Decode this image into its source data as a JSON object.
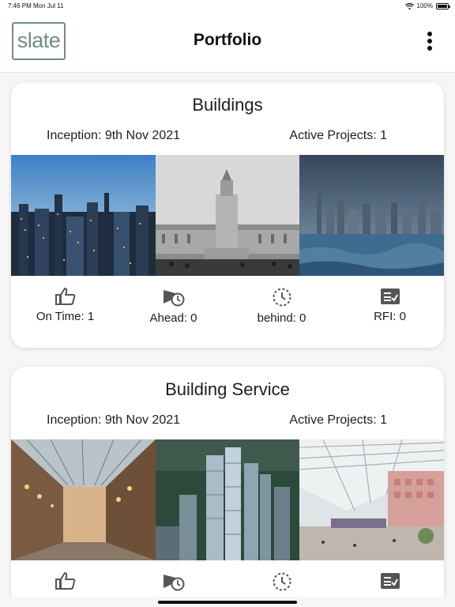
{
  "status_bar": {
    "time": "7:46 PM",
    "date": "Mon Jul 11",
    "battery": "100%"
  },
  "header": {
    "logo_text": "slate",
    "title": "Portfolio"
  },
  "cards": [
    {
      "title": "Buildings",
      "inception": "Inception: 9th Nov 2021",
      "active_projects": "Active Projects: 1",
      "images": [
        "city-skyline-dusk-photo",
        "palace-monument-photo",
        "harbor-skyline-storm-photo"
      ],
      "stats": {
        "on_time": "On Time: 1",
        "ahead": "Ahead: 0",
        "behind": "behind: 0",
        "rfi": "RFI: 0"
      }
    },
    {
      "title": "Building Service",
      "inception": "Inception: 9th Nov 2021",
      "active_projects": "Active Projects: 1",
      "images": [
        "shopping-arcade-photo",
        "skyscraper-towers-photo",
        "atrium-interior-photo"
      ],
      "stats": {
        "on_time": "",
        "ahead": "",
        "behind": "",
        "rfi": ""
      }
    }
  ],
  "colors": {
    "logo": "#6f8f7f",
    "icon": "#555555",
    "background": "#f6f6f6"
  }
}
